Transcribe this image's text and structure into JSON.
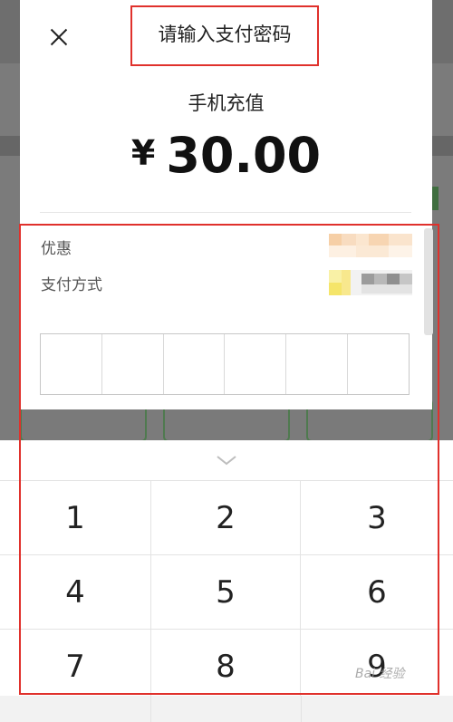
{
  "dialog": {
    "title": "请输入支付密码",
    "product": "手机充值",
    "currency": "¥",
    "amount": "30.00",
    "rows": [
      {
        "label": "优惠"
      },
      {
        "label": "支付方式"
      }
    ],
    "pin_length": 6
  },
  "keypad": {
    "keys": [
      "1",
      "2",
      "3",
      "4",
      "5",
      "6",
      "7",
      "8",
      "9"
    ]
  },
  "watermark": "Bai 经验",
  "colors": {
    "highlight": "#e0312c",
    "overlay": "#7b7b7b",
    "bg_green": "#4f7a4f"
  }
}
